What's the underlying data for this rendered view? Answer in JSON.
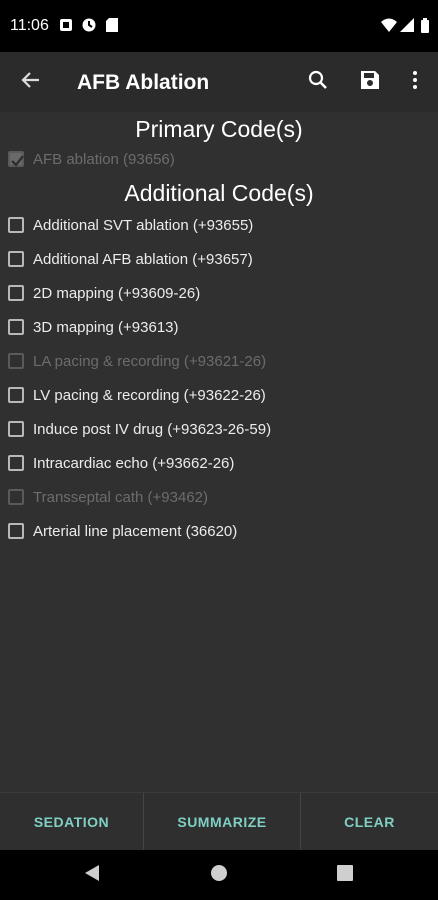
{
  "status_bar": {
    "time": "11:06",
    "left_icons": [
      "notification-a-icon",
      "notification-b-icon",
      "sd-card-icon"
    ],
    "right_icons": [
      "wifi-icon",
      "signal-icon",
      "battery-icon"
    ]
  },
  "app_bar": {
    "title": "AFB Ablation",
    "back_icon": "arrow-left-icon",
    "search_icon": "search-icon",
    "save_icon": "save-icon",
    "more_icon": "more-vert-icon"
  },
  "primary": {
    "heading": "Primary Code(s)",
    "items": [
      {
        "label": "AFB ablation (93656)",
        "checked": true,
        "enabled": false
      }
    ]
  },
  "additional": {
    "heading": "Additional Code(s)",
    "items": [
      {
        "label": "Additional SVT ablation (+93655)",
        "checked": false,
        "enabled": true
      },
      {
        "label": "Additional AFB ablation (+93657)",
        "checked": false,
        "enabled": true
      },
      {
        "label": "2D mapping (+93609-26)",
        "checked": false,
        "enabled": true
      },
      {
        "label": "3D mapping (+93613)",
        "checked": false,
        "enabled": true
      },
      {
        "label": "LA pacing & recording (+93621-26)",
        "checked": false,
        "enabled": false
      },
      {
        "label": "LV pacing & recording (+93622-26)",
        "checked": false,
        "enabled": true
      },
      {
        "label": "Induce post IV drug (+93623-26-59)",
        "checked": false,
        "enabled": true
      },
      {
        "label": "Intracardiac echo (+93662-26)",
        "checked": false,
        "enabled": true
      },
      {
        "label": "Transseptal cath (+93462)",
        "checked": false,
        "enabled": false
      },
      {
        "label": "Arterial line placement (36620)",
        "checked": false,
        "enabled": true
      }
    ]
  },
  "bottom_bar": {
    "sedation": "SEDATION",
    "summarize": "SUMMARIZE",
    "clear": "CLEAR",
    "accent_color": "#7fcfc4"
  },
  "nav_bar": {
    "back": "nav-back-icon",
    "home": "nav-home-icon",
    "recents": "nav-recents-icon"
  }
}
